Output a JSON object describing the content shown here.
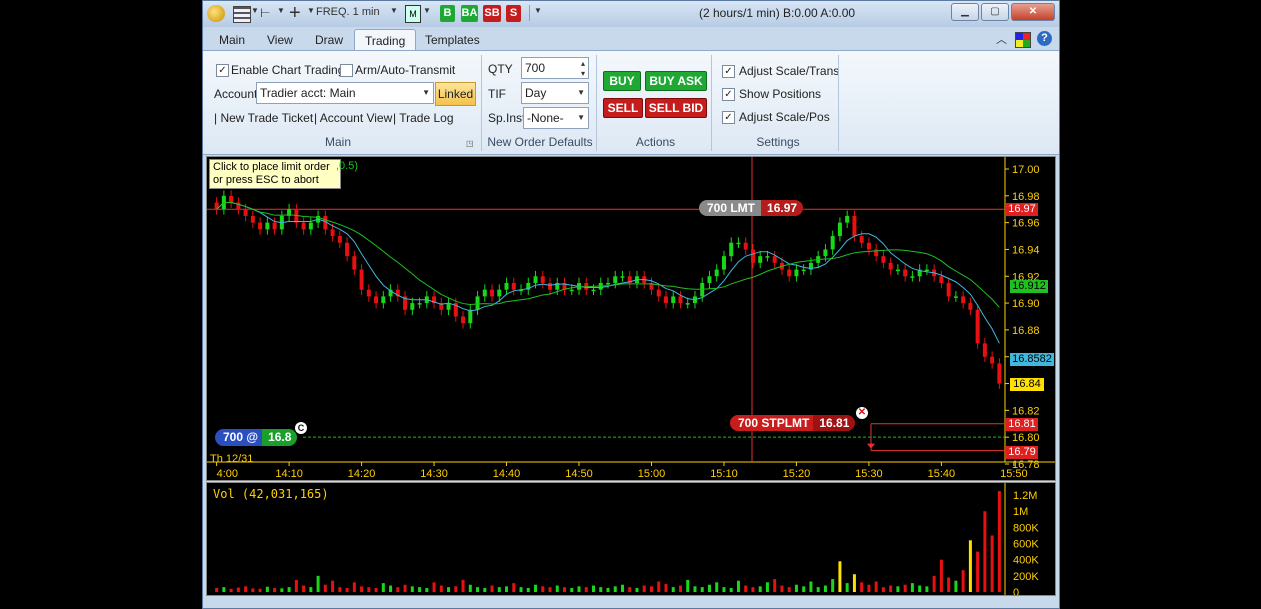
{
  "toolbar": {
    "buttons": [
      "B",
      "BA",
      "SB",
      "S"
    ],
    "freq_label": "FREQ. 1 min"
  },
  "title": "(2 hours/1 min) B:0.00 A:0.00",
  "tabs": [
    "Main",
    "View",
    "Draw",
    "Trading",
    "Templates"
  ],
  "main_group": {
    "enable_chart_trading": "Enable Chart Trading",
    "arm_auto_transmit": "Arm/Auto-Transmit",
    "account_label": "Account",
    "account_value": "Tradier acct: Main",
    "linked_button": "Linked",
    "links": [
      "| New Trade Ticket",
      "| Account View",
      "| Trade Log"
    ],
    "label": "Main"
  },
  "order_defaults": {
    "qty_label": "QTY",
    "qty_value": "700",
    "tif_label": "TIF",
    "tif_value": "Day",
    "spinst_label": "Sp.Inst",
    "spinst_value": "-None-",
    "label": "New Order Defaults"
  },
  "actions": {
    "buy": "BUY",
    "buy_ask": "BUY ASK",
    "sell": "SELL",
    "sell_bid": "SELL BID",
    "label": "Actions"
  },
  "settings": {
    "adjust_scale_trans": "Adjust Scale/Trans",
    "show_positions": "Show Positions",
    "adjust_scale_pos": "Adjust Scale/Pos",
    "label": "Settings"
  },
  "chart": {
    "tooltip_line1": "Click to place limit order",
    "tooltip_line2": "or press ESC to abort",
    "indicator_fragment": ",0.5)",
    "date_label": "Th 12/31",
    "lmt_order_label": "700  LMT",
    "lmt_order_price": "16.97",
    "stplmt_order_label": "700  STPLMT",
    "stplmt_order_price": "16.81",
    "position_qty": "700 @",
    "position_price": "16.8",
    "position_marker": "C",
    "price_tags": {
      "lmt": "16.97",
      "ma": "16.912",
      "ma2": "16.8582",
      "last": "16.84",
      "stp": "16.81",
      "lim": "16.79"
    },
    "volume_label": "Vol (42,031,165)",
    "colors": {
      "up": "#18d818",
      "down": "#e81010",
      "ma_green": "#20c020",
      "ma_cyan": "#3fb8e0",
      "order_line": "#e83030",
      "position_line": "#18c018",
      "axis": "#ffd000"
    }
  },
  "chart_data": {
    "type": "candlestick",
    "x_ticks": [
      "4:00",
      "14:10",
      "14:20",
      "14:30",
      "14:40",
      "14:50",
      "15:00",
      "15:10",
      "15:20",
      "15:30",
      "15:40",
      "15:50"
    ],
    "y_ticks": [
      "17.00",
      "16.98",
      "16.96",
      "16.94",
      "16.92",
      "16.90",
      "16.88",
      "16.86",
      "16.84",
      "16.82",
      "16.80",
      "16.78"
    ],
    "y_range": [
      16.78,
      17.0
    ],
    "volume_ticks": [
      "1.2M",
      "1M",
      "800K",
      "600K",
      "400K",
      "200K",
      "0"
    ],
    "volume_range": [
      0,
      1300000
    ],
    "closes": [
      16.97,
      16.98,
      16.975,
      16.97,
      16.965,
      16.96,
      16.955,
      16.96,
      16.955,
      16.965,
      16.97,
      16.96,
      16.955,
      16.96,
      16.965,
      16.955,
      16.95,
      16.945,
      16.935,
      16.925,
      16.91,
      16.905,
      16.9,
      16.905,
      16.91,
      16.905,
      16.895,
      16.9,
      16.9,
      16.905,
      16.9,
      16.895,
      16.9,
      16.89,
      16.885,
      16.895,
      16.905,
      16.91,
      16.905,
      16.91,
      16.915,
      16.91,
      16.91,
      16.915,
      16.92,
      16.915,
      16.91,
      16.915,
      16.91,
      16.91,
      16.915,
      16.91,
      16.91,
      16.915,
      16.915,
      16.92,
      16.92,
      16.915,
      16.92,
      16.915,
      16.91,
      16.905,
      16.9,
      16.905,
      16.9,
      16.9,
      16.905,
      16.915,
      16.92,
      16.925,
      16.935,
      16.945,
      16.945,
      16.94,
      16.93,
      16.935,
      16.935,
      16.93,
      16.925,
      16.92,
      16.925,
      16.925,
      16.93,
      16.935,
      16.94,
      16.95,
      16.96,
      16.965,
      16.95,
      16.945,
      16.94,
      16.935,
      16.93,
      16.925,
      16.925,
      16.92,
      16.92,
      16.925,
      16.925,
      16.92,
      16.915,
      16.905,
      16.905,
      16.9,
      16.895,
      16.87,
      16.86,
      16.855,
      16.84
    ],
    "volumes": [
      50,
      60,
      40,
      55,
      70,
      45,
      40,
      65,
      50,
      45,
      60,
      150,
      80,
      60,
      200,
      90,
      140,
      60,
      50,
      120,
      70,
      60,
      50,
      110,
      80,
      60,
      90,
      70,
      60,
      50,
      120,
      80,
      60,
      70,
      150,
      90,
      60,
      50,
      80,
      60,
      70,
      110,
      60,
      50,
      90,
      70,
      60,
      80,
      60,
      50,
      70,
      60,
      80,
      60,
      50,
      70,
      90,
      60,
      50,
      80,
      70,
      130,
      100,
      60,
      80,
      150,
      70,
      60,
      90,
      120,
      60,
      50,
      140,
      80,
      60,
      70,
      120,
      160,
      80,
      60,
      90,
      70,
      130,
      60,
      80,
      160,
      380,
      110,
      220,
      120,
      90,
      130,
      60,
      80,
      70,
      90,
      110,
      80,
      70,
      200,
      400,
      180,
      140,
      270,
      640,
      500,
      1000,
      700,
      1250
    ]
  }
}
